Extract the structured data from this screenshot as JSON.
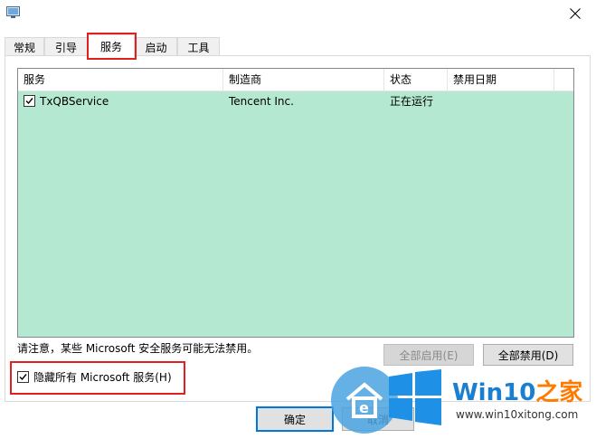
{
  "window": {
    "icon": "msconfig-app-icon",
    "close_icon": "close-icon"
  },
  "tabs": [
    {
      "label": "常规",
      "active": false
    },
    {
      "label": "引导",
      "active": false
    },
    {
      "label": "服务",
      "active": true
    },
    {
      "label": "启动",
      "active": false
    },
    {
      "label": "工具",
      "active": false
    }
  ],
  "services": {
    "columns": [
      "服务",
      "制造商",
      "状态",
      "禁用日期"
    ],
    "rows": [
      {
        "checked": true,
        "service": "TxQBService",
        "manufacturer": "Tencent Inc.",
        "status": "正在运行",
        "disabled_date": ""
      }
    ],
    "background_color": "#b4e8d1"
  },
  "note": "请注意，某些 Microsoft 安全服务可能无法禁用。",
  "buttons": {
    "enable_all": "全部启用(E)",
    "disable_all": "全部禁用(D)",
    "ok": "确定",
    "cancel": "取消"
  },
  "hide_ms": {
    "checked": true,
    "label": "隐藏所有 Microsoft 服务(H)"
  },
  "watermark": {
    "brand_main": "Win10",
    "brand_accent": "之家",
    "url": "www.win10xitong.com"
  },
  "highlight_color": "#e02020"
}
